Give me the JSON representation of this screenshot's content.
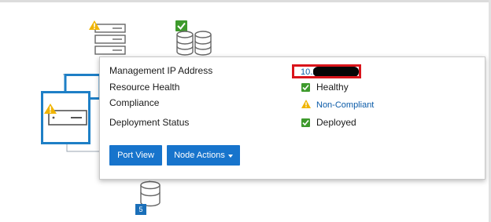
{
  "popup": {
    "rows": [
      {
        "label": "Management IP Address",
        "value": "10.2"
      },
      {
        "label": "Resource Health",
        "value": "Healthy"
      },
      {
        "label": "Compliance",
        "value": "Non-Compliant"
      },
      {
        "label": "Deployment Status",
        "value": "Deployed"
      }
    ],
    "buttons": {
      "port_view": "Port View",
      "node_actions": "Node Actions"
    }
  },
  "topology": {
    "storage_badge_count": "5"
  },
  "colors": {
    "accent_blue": "#1774cc",
    "link_blue": "#0b5ba8",
    "healthy_green": "#3e9a2c",
    "warning_yellow": "#f0b400",
    "highlight_red": "#d9141b"
  },
  "icons": {
    "server_warning": "server-warning-icon",
    "storage_healthy": "storage-healthy-icon",
    "selected_server": "server-selected-icon",
    "storage": "storage-icon"
  }
}
